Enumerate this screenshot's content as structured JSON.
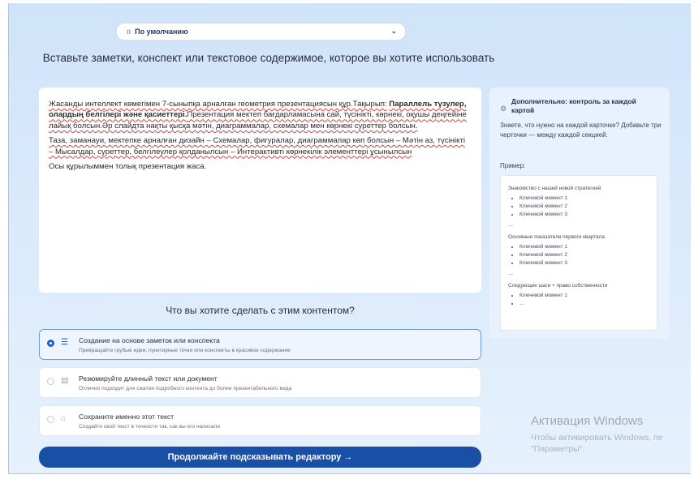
{
  "dropdown": {
    "icon": "grid-icon",
    "value": "По умолчанию"
  },
  "heading": "Вставьте заметки, конспект или текстовое содержимое, которое вы хотите использовать",
  "editor": {
    "p1_part1": "Жасанды интеллект көмегімен 7-сыныпқа арналған геометрия презентациясын құр.Тақырып:",
    "p1_bold": "Параллель түзулер, олардың белгілері және қасиеттері.",
    "p1_part2": "Презентация мектеп бағдарламасына сай, түсінікті, көрнекі, оқушы деңгейіне лайық болсын.Әр слайдта нақты қысқа мәтін, диаграммалар, схемалар мен көрнекі суреттер болсын.",
    "p2": "Таза, заманауи, мектепке арналған дизайн – Схемалар, фигуралар, диаграммалар көп болсын – Мәтін аз, түсінікті – Мысалдар, суреттер, белгілеулер қолданылсын – Интерактивті көрнекілік элементтері ұсынылсын",
    "p3": "Осы құрылыммен толық презентация жаса."
  },
  "question": "Что вы хотите сделать с этим контентом?",
  "options": [
    {
      "title": "Создание на основе заметок или конспекта",
      "subtitle": "Превращайте грубые идеи, пунктирные точки или конспекты в красивое содержание",
      "icon": "list-icon",
      "selected": true
    },
    {
      "title": "Резюмируйте длинный текст или документ",
      "subtitle": "Отлично подходит для сжатия подробного контента до более презентабельного вида",
      "icon": "document-icon",
      "selected": false
    },
    {
      "title": "Сохраните именно этот текст",
      "subtitle": "Создайте свой текст в точности так, как вы его написали",
      "icon": "lock-icon",
      "selected": false
    }
  ],
  "continue_label": "Продолжайте подсказывать редактору →",
  "tips": {
    "icon": "settings-icon",
    "title": "Дополнительно: контроль за каждой картой",
    "body": "Знаете, что нужно на каждой карточке? Добавьте три черточки --- между каждой секцией.",
    "example_label": "Пример:",
    "example": {
      "heading1": "Знакомство с нашей новой стратегией",
      "items1": [
        "Ключевой момент 1",
        "Ключевой момент 2",
        "Ключевой момент 3"
      ],
      "sep": "---",
      "heading2": "Основные показатели первого квартала",
      "items2": [
        "Ключевой момент 1",
        "Ключевой момент 2",
        "Ключевой момент 3"
      ],
      "heading3": "Следующие шаги + право собственности",
      "items3": [
        "Ключевой момент 1",
        "..."
      ]
    }
  },
  "watermark": {
    "title": "Активация Windows",
    "subtitle": "Чтобы активировать Windows, пе \"Параметры\"."
  },
  "colors": {
    "primary_button": "#1a4fa6",
    "selected_border": "#6f9ce0",
    "spell_error": "#d94040"
  }
}
